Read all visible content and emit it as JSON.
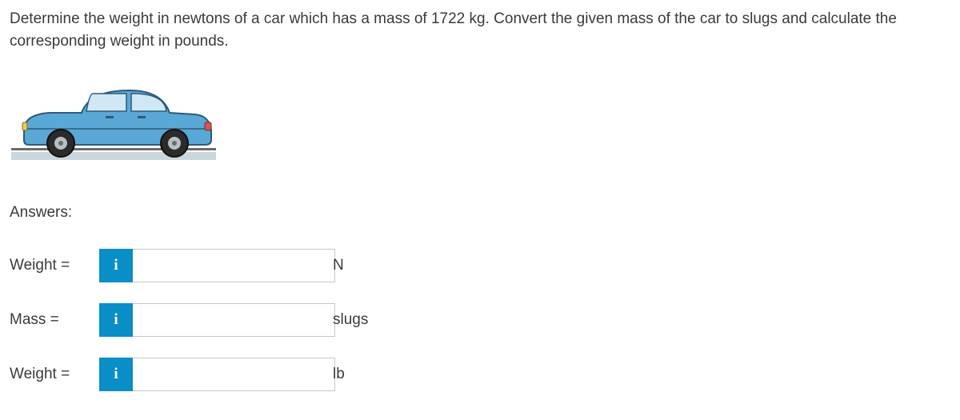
{
  "question_text": "Determine the weight in newtons of a car which has a mass of 1722 kg. Convert the given mass of the car to slugs and calculate the corresponding weight in pounds.",
  "answers_heading": "Answers:",
  "info_glyph": "i",
  "rows": [
    {
      "label": "Weight =",
      "value": "",
      "unit": "N"
    },
    {
      "label": "Mass =",
      "value": "",
      "unit": "slugs"
    },
    {
      "label": "Weight =",
      "value": "",
      "unit": "lb"
    }
  ]
}
